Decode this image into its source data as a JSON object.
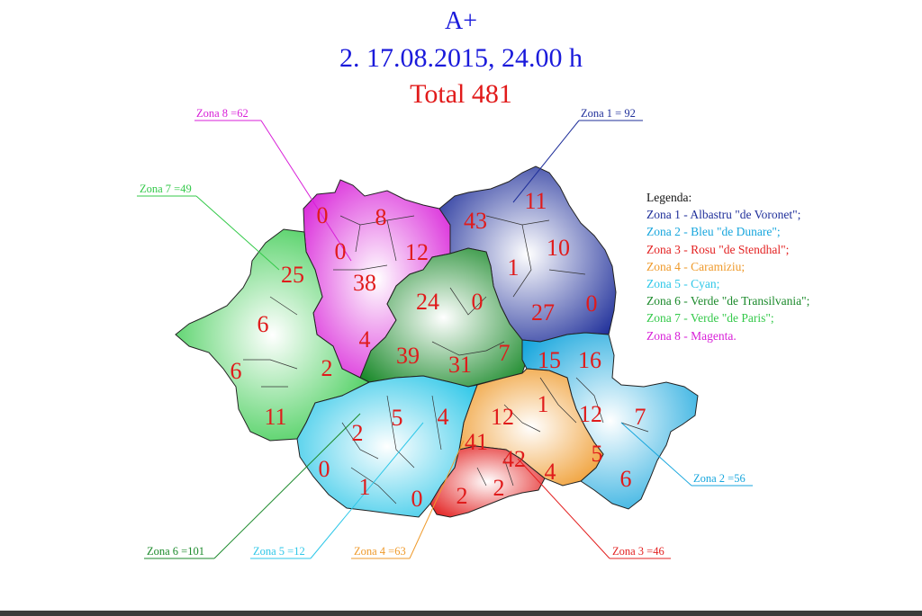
{
  "title": {
    "line1": "A+",
    "line2": "2. 17.08.2015, 24.00 h",
    "line3": "Total 481"
  },
  "colors": {
    "z1": "#1f2f9a",
    "z2": "#17a6dd",
    "z3": "#e32121",
    "z4": "#ef9a2b",
    "z5": "#2ec7e8",
    "z6": "#1b8a2b",
    "z7": "#34c94a",
    "z8": "#d81fd8"
  },
  "legend": {
    "heading": "Legenda:",
    "items": [
      {
        "text": "Zona 1 - Albastru \"de Voronet\";",
        "color": "#1f2f9a"
      },
      {
        "text": "Zona 2 - Bleu \"de Dunare\";",
        "color": "#17a6dd"
      },
      {
        "text": "Zona 3 - Rosu \"de Stendhal\";",
        "color": "#e32121"
      },
      {
        "text": "Zona 4 - Caramiziu;",
        "color": "#ef9a2b"
      },
      {
        "text": "Zona 5 - Cyan;",
        "color": "#2ec7e8"
      },
      {
        "text": "Zona 6 - Verde \"de Transilvania\";",
        "color": "#1b8a2b"
      },
      {
        "text": "Zona 7 - Verde \"de Paris\";",
        "color": "#34c94a"
      },
      {
        "text": "Zona 8 - Magenta.",
        "color": "#d81fd8"
      }
    ]
  },
  "zone_labels": [
    {
      "id": "z8",
      "text": "Zona 8 =62"
    },
    {
      "id": "z1",
      "text": "Zona 1 = 92"
    },
    {
      "id": "z7",
      "text": "Zona 7 =49"
    },
    {
      "id": "z2",
      "text": "Zona 2 =56"
    },
    {
      "id": "z6",
      "text": "Zona 6 =101"
    },
    {
      "id": "z5",
      "text": "Zona 5 =12"
    },
    {
      "id": "z4",
      "text": "Zona 4 =63"
    },
    {
      "id": "z3",
      "text": "Zona 3 =46"
    }
  ],
  "county_values": [
    {
      "zone": "z8",
      "value": "0"
    },
    {
      "zone": "z8",
      "value": "8"
    },
    {
      "zone": "z8",
      "value": "0"
    },
    {
      "zone": "z8",
      "value": "12"
    },
    {
      "zone": "z8",
      "value": "38"
    },
    {
      "zone": "z8",
      "value": "4"
    },
    {
      "zone": "z1",
      "value": "43"
    },
    {
      "zone": "z1",
      "value": "11"
    },
    {
      "zone": "z1",
      "value": "10"
    },
    {
      "zone": "z1",
      "value": "1"
    },
    {
      "zone": "z1",
      "value": "27"
    },
    {
      "zone": "z1",
      "value": "0"
    },
    {
      "zone": "z6",
      "value": "24"
    },
    {
      "zone": "z6",
      "value": "0"
    },
    {
      "zone": "z6",
      "value": "39"
    },
    {
      "zone": "z6",
      "value": "31"
    },
    {
      "zone": "z6",
      "value": "7"
    },
    {
      "zone": "z7",
      "value": "25"
    },
    {
      "zone": "z7",
      "value": "6"
    },
    {
      "zone": "z7",
      "value": "6"
    },
    {
      "zone": "z7",
      "value": "2"
    },
    {
      "zone": "z7",
      "value": "11"
    },
    {
      "zone": "z2",
      "value": "15"
    },
    {
      "zone": "z2",
      "value": "16"
    },
    {
      "zone": "z2",
      "value": "12"
    },
    {
      "zone": "z2",
      "value": "7"
    },
    {
      "zone": "z2",
      "value": "6"
    },
    {
      "zone": "z4",
      "value": "12"
    },
    {
      "zone": "z4",
      "value": "1"
    },
    {
      "zone": "z4",
      "value": "41"
    },
    {
      "zone": "z4",
      "value": "5"
    },
    {
      "zone": "z4",
      "value": "4"
    },
    {
      "zone": "z5",
      "value": "2"
    },
    {
      "zone": "z5",
      "value": "5"
    },
    {
      "zone": "z5",
      "value": "4"
    },
    {
      "zone": "z5",
      "value": "0"
    },
    {
      "zone": "z5",
      "value": "1"
    },
    {
      "zone": "z5",
      "value": "0"
    },
    {
      "zone": "z3",
      "value": "42"
    },
    {
      "zone": "z3",
      "value": "2"
    },
    {
      "zone": "z3",
      "value": "2"
    }
  ]
}
